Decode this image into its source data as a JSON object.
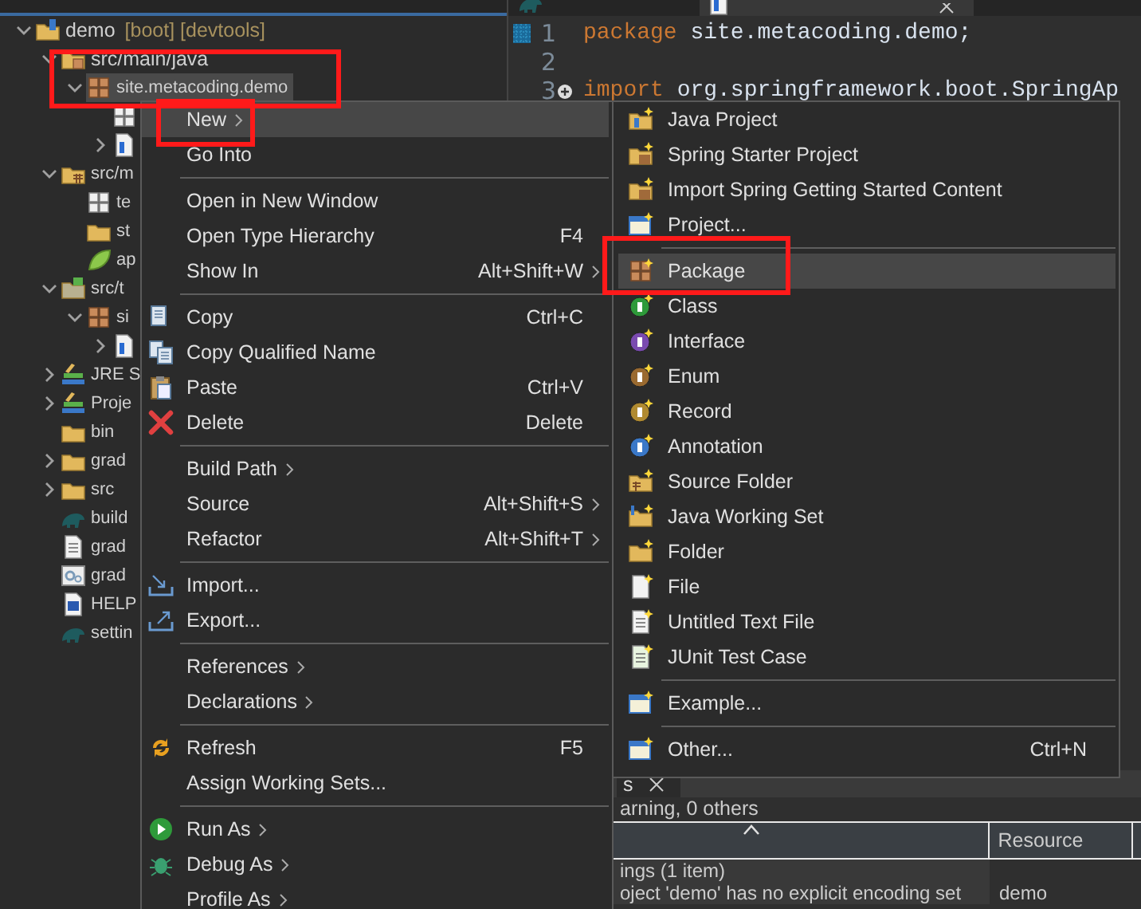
{
  "explorer": {
    "tree": [
      {
        "label": "demo",
        "decoration": "[boot] [devtools]",
        "kind": "project",
        "expanded": true,
        "selected": false,
        "children": [
          {
            "label": "src/main/java",
            "kind": "source-folder",
            "expanded": true,
            "selected": false,
            "children": [
              {
                "label": "site.metacoding.demo",
                "kind": "package",
                "expanded": true,
                "selected": true,
                "children": [
                  {
                    "kind": "package-empty",
                    "selected": false
                  },
                  {
                    "kind": "java-file",
                    "expanded": false,
                    "selected": false
                  }
                ]
              }
            ]
          },
          {
            "label": "src/m",
            "kind": "resource-folder",
            "expanded": true,
            "selected": false,
            "children": [
              {
                "label": "te",
                "kind": "package-empty",
                "selected": false
              },
              {
                "label": "st",
                "kind": "folder",
                "selected": false
              },
              {
                "label": "ap",
                "kind": "leaf",
                "selected": false
              }
            ]
          },
          {
            "label": "src/t",
            "kind": "test-folder",
            "expanded": true,
            "selected": false,
            "children": [
              {
                "label": "si",
                "kind": "package",
                "expanded": true,
                "selected": false,
                "children": [
                  {
                    "kind": "java-file",
                    "expanded": false,
                    "selected": false
                  }
                ]
              }
            ]
          },
          {
            "label": "JRE S",
            "kind": "library",
            "expanded": false,
            "selected": false
          },
          {
            "label": "Proje",
            "kind": "library",
            "expanded": false,
            "selected": false
          },
          {
            "label": "bin",
            "kind": "folder",
            "selected": false
          },
          {
            "label": "grad",
            "kind": "folder",
            "expanded": false,
            "selected": false
          },
          {
            "label": "src",
            "kind": "folder",
            "expanded": false,
            "selected": false
          },
          {
            "label": "build",
            "kind": "gradle",
            "selected": false
          },
          {
            "label": "grad",
            "kind": "text-file",
            "selected": false
          },
          {
            "label": "grad",
            "kind": "settings-file",
            "selected": false
          },
          {
            "label": "HELP",
            "kind": "word-file",
            "selected": false
          },
          {
            "label": "settin",
            "kind": "gradle",
            "selected": false
          }
        ]
      }
    ]
  },
  "editor": {
    "tabs": [
      {
        "kind": "gradle",
        "selected": false
      },
      {
        "kind": "java-file",
        "selected": true,
        "closable": true
      }
    ],
    "lines": [
      {
        "number": "1",
        "marked": true,
        "folded": false,
        "tokens": [
          {
            "text": "package",
            "kind": "keyword"
          },
          {
            "text": " site.metacoding.demo;",
            "kind": "plain"
          }
        ]
      },
      {
        "number": "2",
        "marked": false,
        "folded": false
      },
      {
        "number": "3",
        "marked": false,
        "folded": true,
        "tokens": [
          {
            "text": "import",
            "kind": "keyword"
          },
          {
            "text": " org.springframework.boot.SpringAp",
            "kind": "plain"
          }
        ]
      }
    ]
  },
  "problems": {
    "tab": {
      "label": "s",
      "closable": true,
      "selected": true
    },
    "summary": "arning, 0 others",
    "columns": [
      {
        "sorted": true
      },
      {
        "label": "Resource",
        "sorted": false
      }
    ],
    "rows": [
      {
        "column_1": "ings (1 item)"
      },
      {
        "column_1": "oject 'demo' has no explicit encoding set",
        "column_2": "demo"
      }
    ]
  },
  "context_menu": {
    "items": [
      {
        "label": "New",
        "kind": "plain",
        "has_submenu": true,
        "selected": true
      },
      {
        "label": "Go Into",
        "kind": "plain",
        "has_submenu": false,
        "selected": false
      },
      {
        "kind": "separator"
      },
      {
        "label": "Open in New Window",
        "kind": "plain",
        "has_submenu": false,
        "selected": false
      },
      {
        "label": "Open Type Hierarchy",
        "shortcut": "F4",
        "kind": "plain",
        "has_submenu": false,
        "selected": false
      },
      {
        "label": "Show In",
        "shortcut": "Alt+Shift+W",
        "kind": "plain",
        "has_submenu": true,
        "selected": false
      },
      {
        "kind": "separator"
      },
      {
        "label": "Copy",
        "shortcut": "Ctrl+C",
        "kind": "copy",
        "has_submenu": false,
        "selected": false
      },
      {
        "label": "Copy Qualified Name",
        "kind": "copy-name",
        "has_submenu": false,
        "selected": false
      },
      {
        "label": "Paste",
        "shortcut": "Ctrl+V",
        "kind": "paste",
        "has_submenu": false,
        "selected": false
      },
      {
        "label": "Delete",
        "shortcut": "Delete",
        "kind": "delete",
        "has_submenu": false,
        "selected": false
      },
      {
        "kind": "separator"
      },
      {
        "label": "Build Path",
        "kind": "plain",
        "has_submenu": true,
        "selected": false
      },
      {
        "label": "Source",
        "shortcut": "Alt+Shift+S",
        "kind": "plain",
        "has_submenu": true,
        "selected": false
      },
      {
        "label": "Refactor",
        "shortcut": "Alt+Shift+T",
        "kind": "plain",
        "has_submenu": true,
        "selected": false
      },
      {
        "kind": "separator"
      },
      {
        "label": "Import...",
        "kind": "import",
        "has_submenu": false,
        "selected": false
      },
      {
        "label": "Export...",
        "kind": "export",
        "has_submenu": false,
        "selected": false
      },
      {
        "kind": "separator"
      },
      {
        "label": "References",
        "kind": "plain",
        "has_submenu": true,
        "selected": false
      },
      {
        "label": "Declarations",
        "kind": "plain",
        "has_submenu": true,
        "selected": false
      },
      {
        "kind": "separator"
      },
      {
        "label": "Refresh",
        "shortcut": "F5",
        "kind": "refresh",
        "has_submenu": false,
        "selected": false
      },
      {
        "label": "Assign Working Sets...",
        "kind": "plain",
        "has_submenu": false,
        "selected": false
      },
      {
        "kind": "separator"
      },
      {
        "label": "Run As",
        "kind": "run",
        "has_submenu": true,
        "selected": false
      },
      {
        "label": "Debug As",
        "kind": "debug",
        "has_submenu": true,
        "selected": false
      },
      {
        "label": "Profile As",
        "kind": "plain",
        "has_submenu": true,
        "selected": false
      }
    ]
  },
  "new_submenu": {
    "items": [
      {
        "label": "Java Project",
        "kind": "java-project",
        "selected": false
      },
      {
        "label": "Spring Starter Project",
        "kind": "spring-project",
        "selected": false
      },
      {
        "label": "Import Spring Getting Started Content",
        "kind": "spring-project",
        "selected": false
      },
      {
        "label": "Project...",
        "kind": "project",
        "selected": false
      },
      {
        "kind": "separator"
      },
      {
        "label": "Package",
        "kind": "package",
        "selected": true
      },
      {
        "label": "Class",
        "kind": "class",
        "selected": false
      },
      {
        "label": "Interface",
        "kind": "interface",
        "selected": false
      },
      {
        "label": "Enum",
        "kind": "enum",
        "selected": false
      },
      {
        "label": "Record",
        "kind": "record",
        "selected": false
      },
      {
        "label": "Annotation",
        "kind": "annotation",
        "selected": false
      },
      {
        "label": "Source Folder",
        "kind": "source-folder",
        "selected": false
      },
      {
        "label": "Java Working Set",
        "kind": "working-set",
        "selected": false
      },
      {
        "label": "Folder",
        "kind": "folder",
        "selected": false
      },
      {
        "label": "File",
        "kind": "file",
        "selected": false
      },
      {
        "label": "Untitled Text File",
        "kind": "text-file",
        "selected": false
      },
      {
        "label": "JUnit Test Case",
        "kind": "junit",
        "selected": false
      },
      {
        "kind": "separator"
      },
      {
        "label": "Example...",
        "kind": "project",
        "selected": false
      },
      {
        "kind": "separator"
      },
      {
        "label": "Other...",
        "shortcut": "Ctrl+N",
        "kind": "project",
        "selected": false
      }
    ]
  }
}
